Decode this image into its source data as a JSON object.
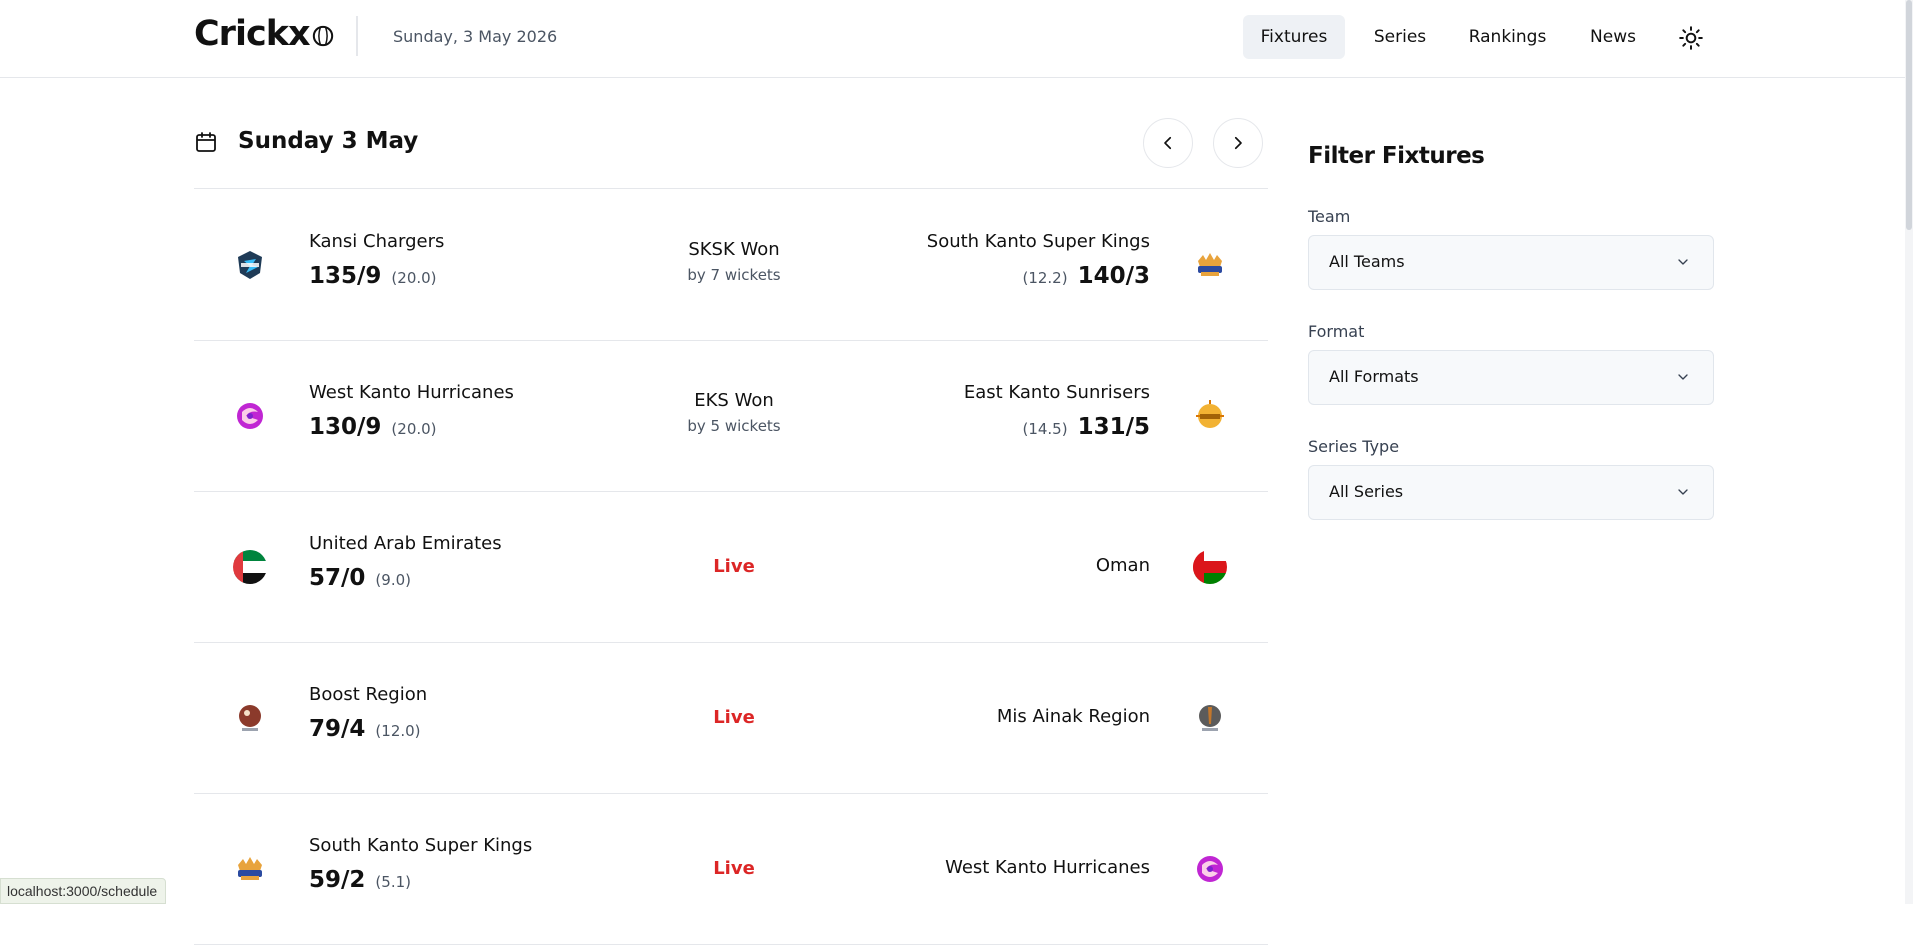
{
  "header": {
    "logo": "Crickx",
    "date": "Sunday, 3 May 2026",
    "nav": [
      {
        "label": "Fixtures",
        "active": true
      },
      {
        "label": "Series",
        "active": false
      },
      {
        "label": "Rankings",
        "active": false
      },
      {
        "label": "News",
        "active": false
      }
    ],
    "theme_icon": "sun-icon"
  },
  "fixtures": {
    "day_title": "Sunday 3 May",
    "matches": [
      {
        "team1": "Kansi Chargers",
        "team1_score": "135/9",
        "team1_overs": "(20.0)",
        "team2": "South Kanto Super Kings",
        "team2_score": "140/3",
        "team2_overs": "(12.2)",
        "status": "result",
        "result_title": "SKSK Won",
        "result_sub": "by 7 wickets"
      },
      {
        "team1": "West Kanto Hurricanes",
        "team1_score": "130/9",
        "team1_overs": "(20.0)",
        "team2": "East Kanto Sunrisers",
        "team2_score": "131/5",
        "team2_overs": "(14.5)",
        "status": "result",
        "result_title": "EKS Won",
        "result_sub": "by 5 wickets"
      },
      {
        "team1": "United Arab Emirates",
        "team1_score": "57/0",
        "team1_overs": "(9.0)",
        "team2": "Oman",
        "status": "live",
        "status_label": "Live"
      },
      {
        "team1": "Boost Region",
        "team1_score": "79/4",
        "team1_overs": "(12.0)",
        "team2": "Mis Ainak Region",
        "status": "live",
        "status_label": "Live"
      },
      {
        "team1": "South Kanto Super Kings",
        "team1_score": "59/2",
        "team1_overs": "(5.1)",
        "team2": "West Kanto Hurricanes",
        "status": "live",
        "status_label": "Live"
      }
    ]
  },
  "filters": {
    "title": "Filter Fixtures",
    "team": {
      "label": "Team",
      "value": "All Teams"
    },
    "format": {
      "label": "Format",
      "value": "All Formats"
    },
    "series_type": {
      "label": "Series Type",
      "value": "All Series"
    }
  },
  "status_bar": {
    "url": "localhost:3000/schedule"
  },
  "colors": {
    "live": "#dc2626",
    "active_nav_bg": "#eef1f5"
  }
}
